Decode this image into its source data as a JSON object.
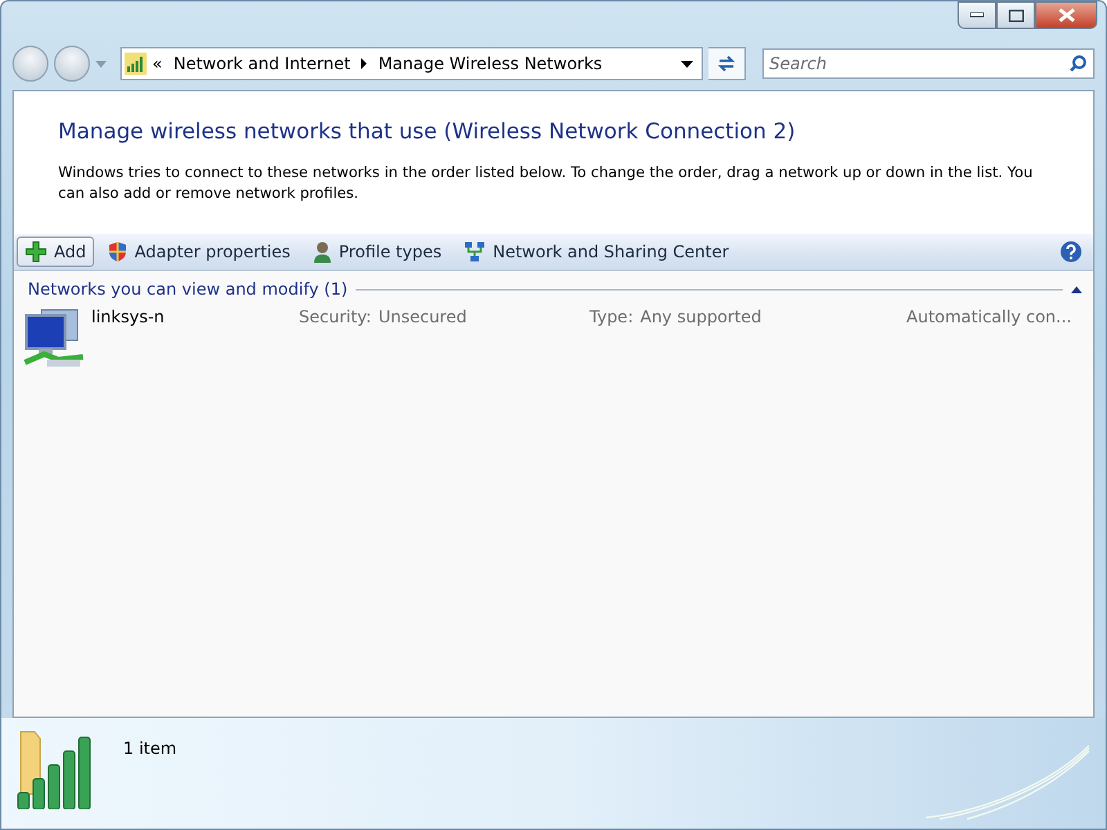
{
  "address_bar": {
    "overflow": "«",
    "crumbs": [
      "Network and Internet",
      "Manage Wireless Networks"
    ]
  },
  "search": {
    "placeholder": "Search"
  },
  "heading": "Manage wireless networks that use (Wireless Network Connection 2)",
  "description": "Windows tries to connect to these networks in the order listed below. To change the order, drag a network up or down in the list. You can also add or remove network profiles.",
  "toolbar": [
    {
      "label": "Add",
      "kind": "add",
      "highlighted": true
    },
    {
      "label": "Adapter properties",
      "kind": "shield",
      "highlighted": false
    },
    {
      "label": "Profile types",
      "kind": "person",
      "highlighted": false
    },
    {
      "label": "Network and Sharing Center",
      "kind": "network",
      "highlighted": false
    }
  ],
  "group": {
    "title": "Networks you can view and modify (1)",
    "expanded": true
  },
  "networks": [
    {
      "name": "linksys-n",
      "security_label": "Security:",
      "security": "Unsecured",
      "type_label": "Type:",
      "type": "Any supported",
      "mode": "Automatically con..."
    }
  ],
  "status_bar": {
    "text": "1 item"
  }
}
